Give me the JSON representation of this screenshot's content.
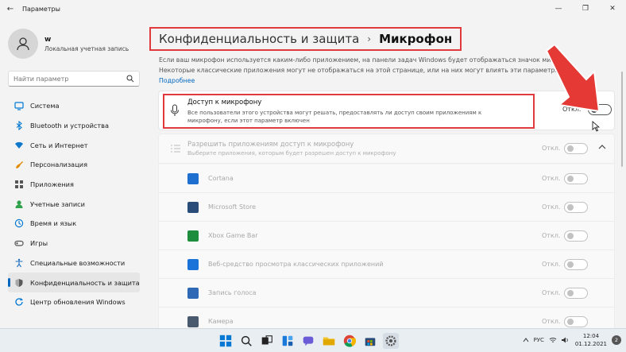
{
  "window": {
    "title": "Параметры",
    "back_icon": "←",
    "minimize_icon": "—",
    "maximize_icon": "❐",
    "close_icon": "✕"
  },
  "user": {
    "name": "w",
    "account_type": "Локальная учетная запись"
  },
  "search": {
    "placeholder": "Найти параметр"
  },
  "sidebar": {
    "items": [
      {
        "label": "Система",
        "icon": "monitor-icon",
        "color": "#0078d4"
      },
      {
        "label": "Bluetooth и устройства",
        "icon": "bluetooth-icon",
        "color": "#0078d4"
      },
      {
        "label": "Сеть и Интернет",
        "icon": "wifi-icon",
        "color": "#0f78c8"
      },
      {
        "label": "Персонализация",
        "icon": "brush-icon",
        "color": "#e08a00"
      },
      {
        "label": "Приложения",
        "icon": "apps-icon",
        "color": "#555555"
      },
      {
        "label": "Учетные записи",
        "icon": "account-icon",
        "color": "#2fa24b"
      },
      {
        "label": "Время и язык",
        "icon": "globe-clock-icon",
        "color": "#0078d4"
      },
      {
        "label": "Игры",
        "icon": "gamepad-icon",
        "color": "#555555"
      },
      {
        "label": "Специальные возможности",
        "icon": "accessibility-icon",
        "color": "#1a6fc2"
      },
      {
        "label": "Конфиденциальность и защита",
        "icon": "shield-icon",
        "color": "#5a5a5a",
        "active": true
      },
      {
        "label": "Центр обновления Windows",
        "icon": "update-icon",
        "color": "#0078d4"
      }
    ]
  },
  "header": {
    "section": "Конфиденциальность и защита",
    "separator": "›",
    "page": "Микрофон"
  },
  "description": {
    "text": "Если ваш микрофон используется каким-либо приложением, на панели задач Windows будет отображаться значок микр... Некоторые классические приложения могут не отображаться на этой странице, или на них могут влиять эти параметры.",
    "link": "Подробнее"
  },
  "mic_access": {
    "title": "Доступ к микрофону",
    "subtitle": "Все пользователи этого устройства могут решать, предоставлять ли доступ своим приложениям к микрофону, если этот параметр включен",
    "state_label": "Откл.",
    "on": false
  },
  "app_access": {
    "title": "Разрешить приложениям доступ к микрофону",
    "subtitle": "Выберите приложения, которым будет разрешен доступ к микрофону",
    "state_label": "Откл.",
    "on": false
  },
  "apps": [
    {
      "name": "Cortana",
      "color": "#1f6fd1"
    },
    {
      "name": "Microsoft Store",
      "color": "#2a4c78"
    },
    {
      "name": "Xbox Game Bar",
      "color": "#1e8e3e"
    },
    {
      "name": "Веб-средство просмотра классических приложений",
      "color": "#1a73d9"
    },
    {
      "name": "Запись голоса",
      "color": "#2f68b5"
    },
    {
      "name": "Камера",
      "color": "#4a5a6e"
    }
  ],
  "app_state_label": "Откл.",
  "taskbar": {
    "icons": [
      "windows-start-icon",
      "search-icon",
      "task-view-icon",
      "widgets-icon",
      "chat-icon",
      "file-explorer-icon",
      "chrome-icon",
      "store-icon",
      "settings-icon"
    ],
    "language": "РУС",
    "time": "12:04",
    "date": "01.12.2021",
    "notification_count": "2"
  }
}
